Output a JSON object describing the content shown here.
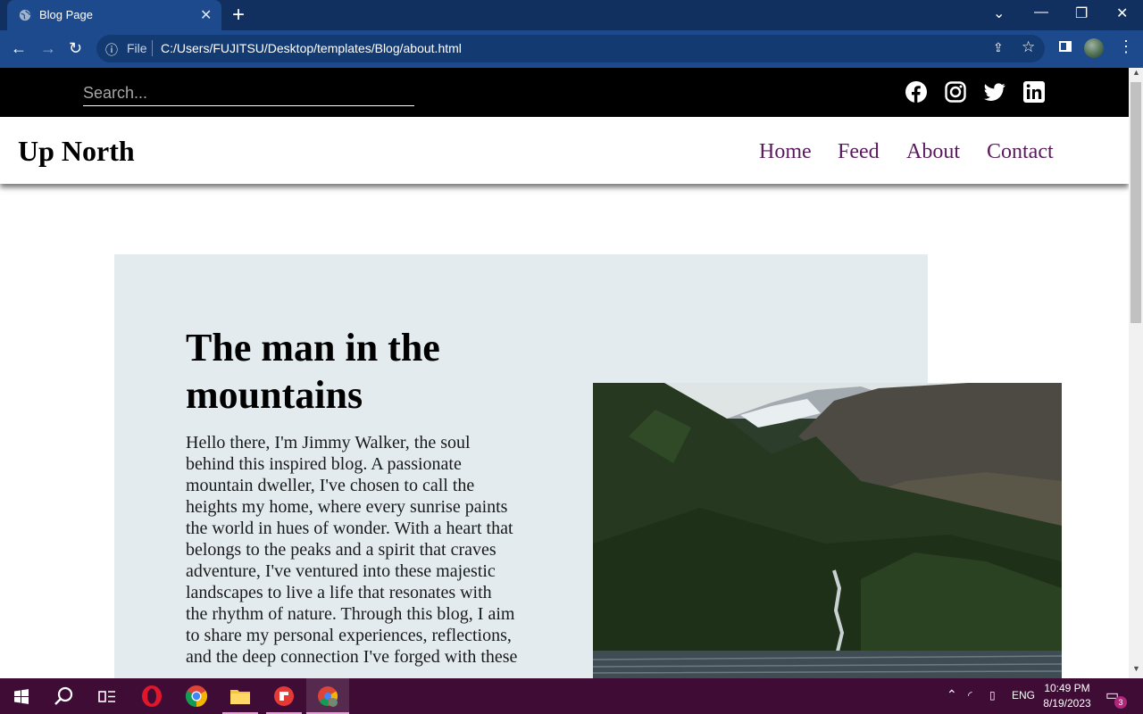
{
  "browser": {
    "tab_title": "Blog Page",
    "address_scheme_label": "File",
    "address_url": "C:/Users/FUJITSU/Desktop/templates/Blog/about.html"
  },
  "site": {
    "search_placeholder": "Search...",
    "social_icons": [
      "facebook-icon",
      "instagram-icon",
      "twitter-icon",
      "linkedin-icon"
    ],
    "brand": "Up North",
    "nav": [
      "Home",
      "Feed",
      "About",
      "Contact"
    ]
  },
  "article": {
    "title": "The man in the mountains",
    "body": "Hello there, I'm Jimmy Walker, the soul behind this inspired blog. A passionate mountain dweller, I've chosen to call the heights my home, where every sunrise paints the world in hues of wonder. With a heart that belongs to the peaks and a spirit that craves adventure, I've ventured into these majestic landscapes to live a life that resonates with the rhythm of nature. Through this blog, I aim to share my personal experiences, reflections, and the deep connection I've forged with these"
  },
  "taskbar": {
    "language": "ENG",
    "time": "10:49 PM",
    "date": "8/19/2023",
    "notification_count": "3"
  },
  "colors": {
    "nav_link": "#5a1a5e",
    "card_bg": "#e3ebef",
    "browser_frame": "#1d4a8c",
    "taskbar": "#3f0c36"
  }
}
